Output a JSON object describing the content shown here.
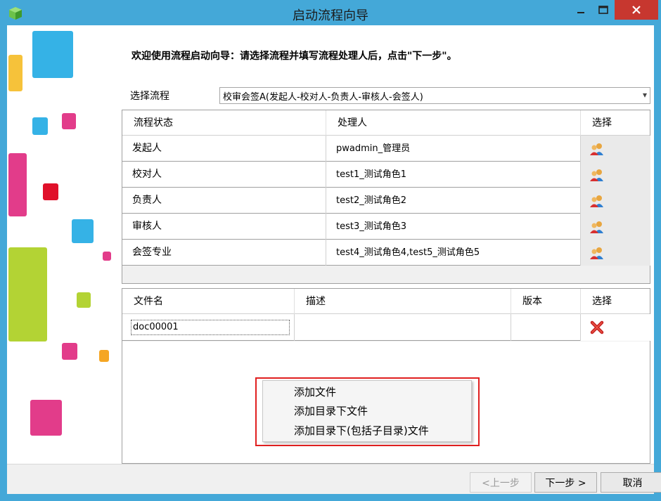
{
  "window": {
    "title": "启动流程向导",
    "controls": {
      "minimize": "minimize-icon",
      "maximize": "maximize-icon",
      "close": "close-icon"
    }
  },
  "welcome_text": "欢迎使用流程启动向导：请选择流程并填写流程处理人后，点击\"下一步\"。",
  "process_select": {
    "label": "选择流程",
    "value": "校审会签A(发起人-校对人-负责人-审核人-会签人)"
  },
  "handlers_table": {
    "columns": [
      "流程状态",
      "处理人",
      "选择"
    ],
    "rows": [
      {
        "status": "发起人",
        "handler": "pwadmin_管理员",
        "action_icon": "select-user-icon"
      },
      {
        "status": "校对人",
        "handler": "test1_测试角色1",
        "action_icon": "select-user-icon"
      },
      {
        "status": "负责人",
        "handler": "test2_测试角色2",
        "action_icon": "select-user-icon"
      },
      {
        "status": "审核人",
        "handler": "test3_测试角色3",
        "action_icon": "select-user-icon"
      },
      {
        "status": "会签专业",
        "handler": "test4_测试角色4,test5_测试角色5",
        "action_icon": "select-user-icon"
      }
    ]
  },
  "files_table": {
    "columns": [
      "文件名",
      "描述",
      "版本",
      "选择"
    ],
    "rows": [
      {
        "name": "doc00001",
        "description": "",
        "version": "",
        "action_icon": "delete-icon"
      }
    ]
  },
  "context_menu": {
    "items": [
      "添加文件",
      "添加目录下文件",
      "添加目录下(包括子目录)文件"
    ]
  },
  "footer": {
    "prev": "<上一步",
    "next": "下一步 >",
    "cancel": "取消"
  },
  "colors": {
    "titlebar": "#44a8d8",
    "close_button": "#c7372f",
    "highlight_frame": "#e02020"
  }
}
